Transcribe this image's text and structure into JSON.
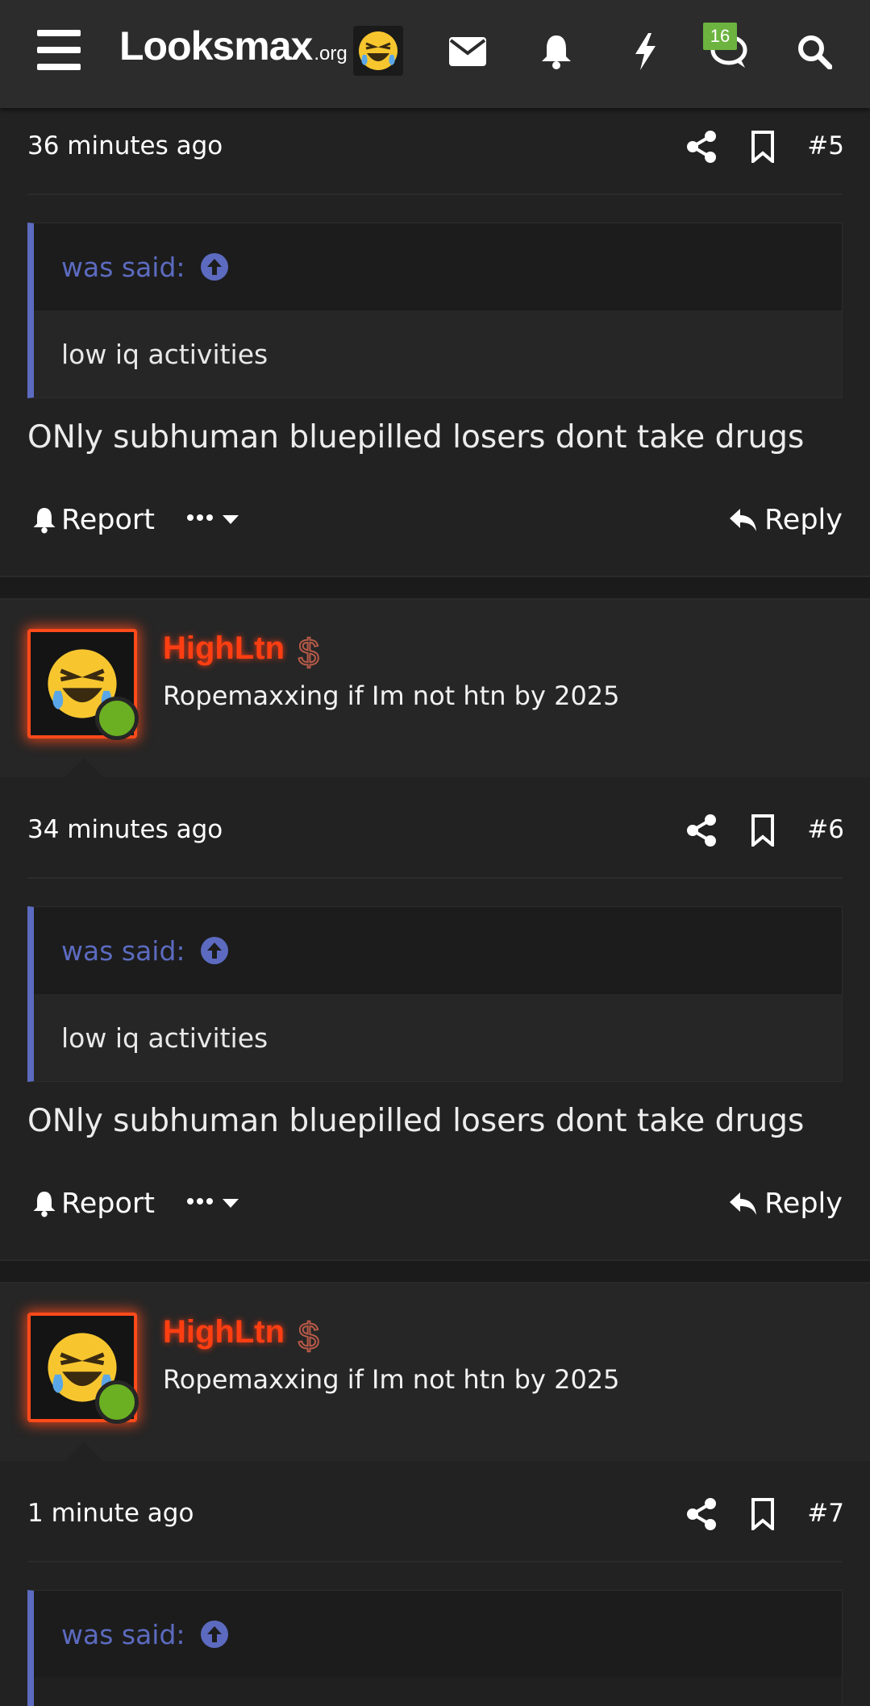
{
  "header": {
    "logo_main": "Looksmax",
    "logo_tld": ".org",
    "logo_emoji_icon": "crying-laughing-emoji-icon",
    "chat_badge": "16",
    "icons": [
      "menu-icon",
      "mail-icon",
      "bell-icon",
      "bolt-icon",
      "chat-icon",
      "search-icon"
    ]
  },
  "posts": [
    {
      "time": "36 minutes ago",
      "number": "#5",
      "quote_head": "was said:",
      "quote_text": "low iq activities",
      "text": "ONly subhuman bluepilled losers dont take drugs"
    },
    {
      "username": "HighLtn",
      "user_title": "Ropemaxxing if Im not htn by 2025",
      "user_symbol": "$",
      "time": "34 minutes ago",
      "number": "#6",
      "quote_head": "was said:",
      "quote_text": "low iq activities",
      "text": "ONly subhuman bluepilled losers dont take drugs"
    },
    {
      "username": "HighLtn",
      "user_title": "Ropemaxxing if Im not htn by 2025",
      "user_symbol": "$",
      "time": "1 minute ago",
      "number": "#7",
      "quote_head": "was said:"
    }
  ],
  "actions": {
    "report_label": "Report",
    "reply_label": "Reply"
  },
  "colors": {
    "background": "#222222",
    "header": "#2c2c2c",
    "quote_accent": "#5c6bc0",
    "username": "#ff3e12",
    "online": "#6ab022",
    "badge": "#6cb33f"
  }
}
